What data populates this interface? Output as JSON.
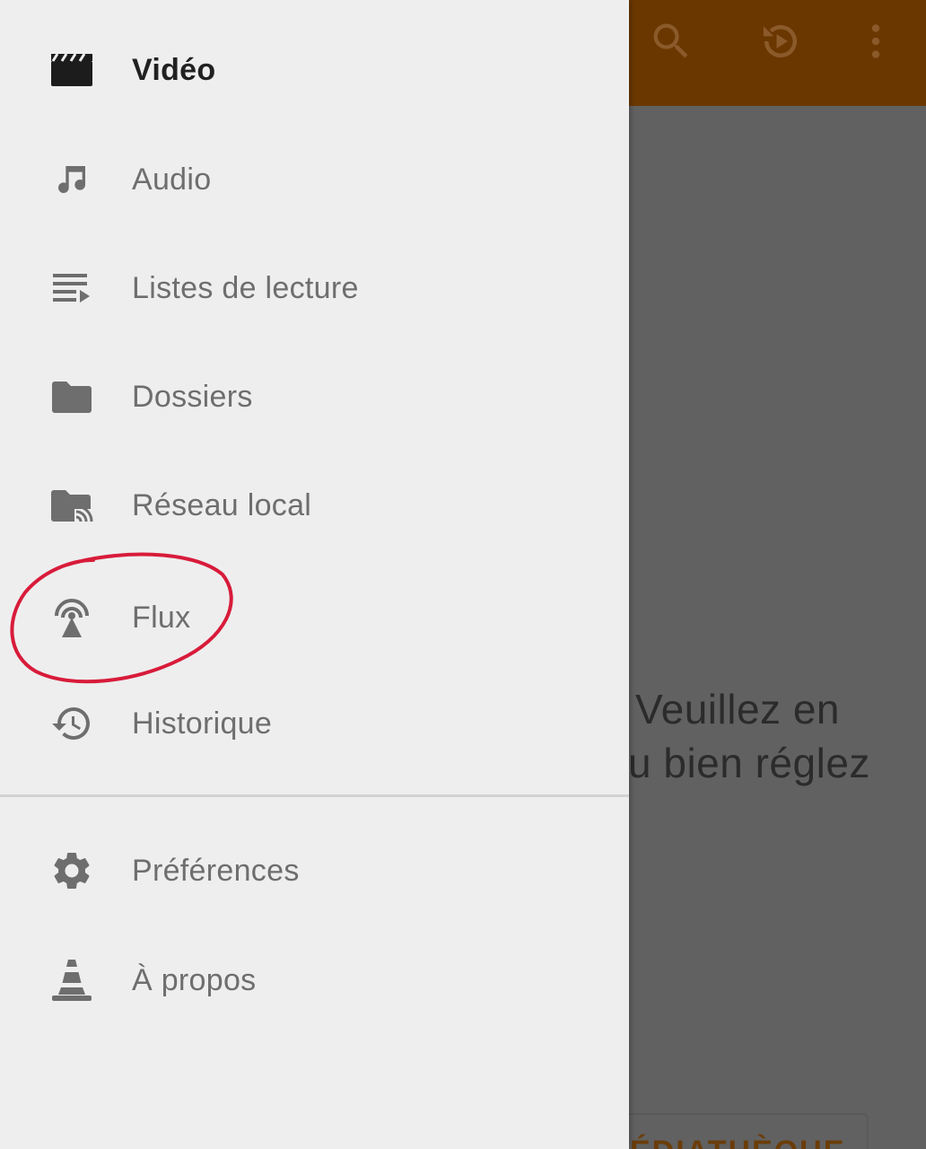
{
  "background_app": {
    "empty_message_line1": "Veuillez en",
    "empty_message_line2": "u bien réglez",
    "library_button_label": "ÉDIATHÈQUE",
    "appbar_color": "#6b3700",
    "actions": [
      {
        "icon": "search-icon"
      },
      {
        "icon": "history-play-icon"
      },
      {
        "icon": "more-vert-icon"
      }
    ]
  },
  "drawer": {
    "items": [
      {
        "label": "Vidéo",
        "icon": "movie-icon",
        "active": true
      },
      {
        "label": "Audio",
        "icon": "music-note-icon",
        "active": false
      },
      {
        "label": "Listes de lecture",
        "icon": "playlist-icon",
        "active": false
      },
      {
        "label": "Dossiers",
        "icon": "folder-icon",
        "active": false
      },
      {
        "label": "Réseau local",
        "icon": "network-folder-icon",
        "active": false
      },
      {
        "label": "Flux",
        "icon": "stream-antenna-icon",
        "active": false
      },
      {
        "label": "Historique",
        "icon": "history-icon",
        "active": false
      }
    ],
    "secondary_items": [
      {
        "label": "Préférences",
        "icon": "gear-icon"
      },
      {
        "label": "À propos",
        "icon": "vlc-cone-icon"
      }
    ]
  },
  "annotation": {
    "color": "#d81b3a",
    "target": "Flux"
  }
}
